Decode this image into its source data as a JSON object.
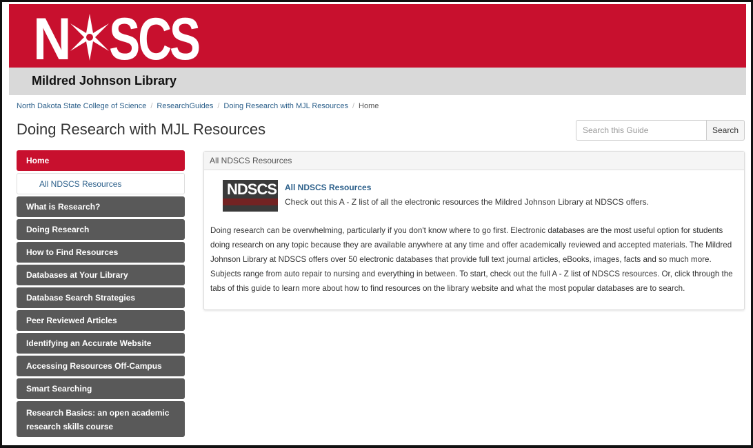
{
  "header": {
    "logo_text": "NDSCS",
    "library_name": "Mildred Johnson Library",
    "brand_color": "#c8102e"
  },
  "breadcrumb": [
    {
      "label": "North Dakota State College of Science"
    },
    {
      "label": "ResearchGuides"
    },
    {
      "label": "Doing Research with MJL Resources"
    },
    {
      "label": "Home"
    }
  ],
  "page": {
    "title": "Doing Research with MJL Resources"
  },
  "search": {
    "placeholder": "Search this Guide",
    "button_label": "Search"
  },
  "sidenav": {
    "items": [
      {
        "label": "Home",
        "active": true
      },
      {
        "label": "All NDSCS Resources",
        "sub": true
      },
      {
        "label": "What is Research?"
      },
      {
        "label": "Doing Research"
      },
      {
        "label": "How to Find Resources"
      },
      {
        "label": "Databases at Your Library"
      },
      {
        "label": "Database Search Strategies"
      },
      {
        "label": "Peer Reviewed Articles"
      },
      {
        "label": "Identifying an Accurate Website"
      },
      {
        "label": "Accessing Resources Off-Campus"
      },
      {
        "label": "Smart Searching"
      },
      {
        "label": "Research Basics: an open academic research skills course"
      }
    ]
  },
  "panel": {
    "heading": "All NDSCS Resources",
    "resource": {
      "thumb_text": "NDSCS",
      "link_label": "All NDSCS Resources",
      "description": "Check out this A - Z list of all the electronic resources the Mildred Johnson Library at NDSCS offers."
    },
    "body": "Doing research can be overwhelming, particularly if you don't know where to go first. Electronic databases are the most useful option for students doing research on any topic because they are available anywhere at any time and offer academically reviewed and accepted materials. The Mildred Johnson Library at NDSCS offers over 50 electronic databases that provide full text journal articles, eBooks, images, facts and so much more. Subjects range from auto repair to nursing and everything in between. To start, check out the full A - Z list of NDSCS resources. Or, click through the tabs of this guide to learn more about how to find resources on the library website and what the most popular databases are to search."
  }
}
